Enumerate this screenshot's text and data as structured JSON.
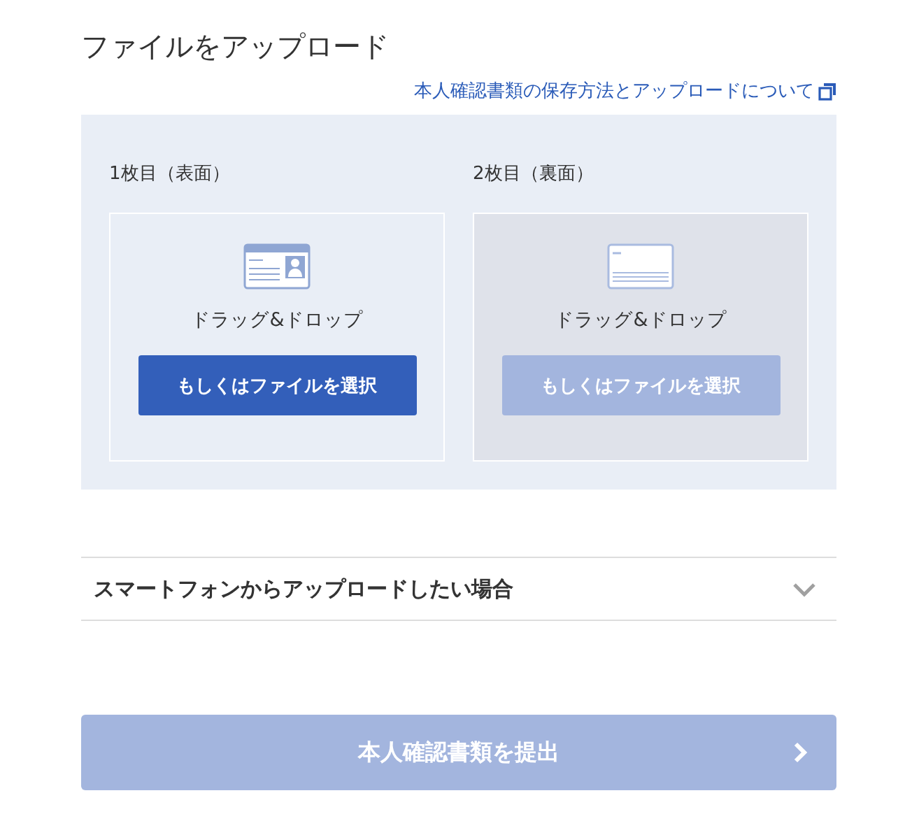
{
  "title": "ファイルをアップロード",
  "help_link": "本人確認書類の保存方法とアップロードについて",
  "slots": [
    {
      "label": "1枚目（表面）",
      "kind": "front",
      "disabled": false,
      "drop_text": "ドラッグ&ドロップ",
      "button": "もしくはファイルを選択"
    },
    {
      "label": "2枚目（裏面）",
      "kind": "back",
      "disabled": true,
      "drop_text": "ドラッグ&ドロップ",
      "button": "もしくはファイルを選択"
    }
  ],
  "accordion": {
    "label": "スマートフォンからアップロードしたい場合",
    "expanded": false
  },
  "submit": {
    "label": "本人確認書類を提出",
    "disabled": true
  }
}
